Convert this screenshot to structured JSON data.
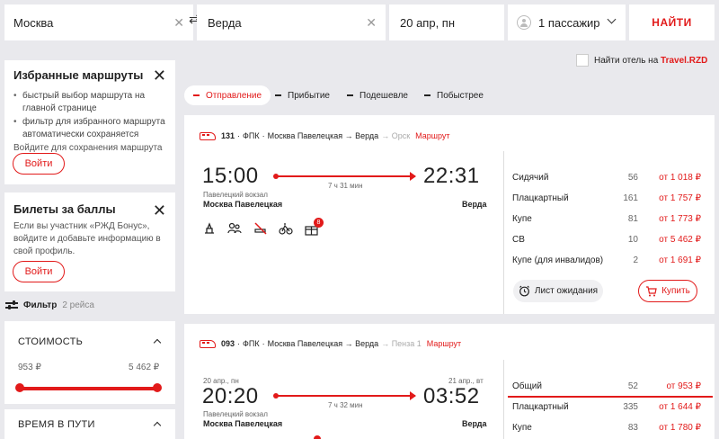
{
  "search": {
    "from": "Москва",
    "to": "Верда",
    "date": "20 апр, пн",
    "passengers": "1 пассажир",
    "find_label": "НАЙТИ"
  },
  "hotel": {
    "prefix": "Найти отель на",
    "brand": "Travel.RZD"
  },
  "favorites": {
    "title": "Избранные маршруты",
    "bullets": [
      "быстрый выбор маршрута на главной странице",
      "фильтр для избранного маршрута автоматически сохраняется"
    ],
    "hint": "Войдите для сохранения маршрута",
    "login": "Войти"
  },
  "bonus": {
    "title": "Билеты за баллы",
    "text": "Если вы участник «РЖД Бонус», войдите и добавьте информацию в свой профиль.",
    "login": "Войти"
  },
  "filter": {
    "label": "Фильтр",
    "count": "2 рейса",
    "cost_title": "СТОИМОСТЬ",
    "min": "953 ₽",
    "max": "5 462 ₽",
    "travel_time_title": "ВРЕМЯ В ПУТИ"
  },
  "sort": {
    "tabs": [
      "Отправление",
      "Прибытие",
      "Подешевле",
      "Побыстрее"
    ],
    "active": 0
  },
  "trains": [
    {
      "number": "131",
      "carrier": "ФПК",
      "route": "Москва Павелецкая → Верда",
      "extra": "→ Орск",
      "route_link": "Маршрут",
      "dep_date": "",
      "arr_date": "",
      "dep_time": "15:00",
      "arr_time": "22:31",
      "duration": "7 ч 31 мин",
      "dep_station_note": "Павелецкий вокзал",
      "dep_station": "Москва Павелецкая",
      "arr_station": "Верда",
      "amenities": [
        "pet-icon",
        "companions-icon",
        "no-smoking-icon",
        "bike-icon",
        "gift-box-icon"
      ],
      "gift_badge": "8",
      "classes": [
        {
          "name": "Сидячий",
          "count": "56",
          "price": "от 1 018 ₽"
        },
        {
          "name": "Плацкартный",
          "count": "161",
          "price": "от 1 757 ₽"
        },
        {
          "name": "Купе",
          "count": "81",
          "price": "от 1 773 ₽"
        },
        {
          "name": "СВ",
          "count": "10",
          "price": "от 5 462 ₽"
        },
        {
          "name": "Купе (для инвалидов)",
          "count": "2",
          "price": "от 1 691 ₽"
        }
      ],
      "wait_label": "Лист ожидания",
      "buy_label": "Купить"
    },
    {
      "number": "093",
      "carrier": "ФПК",
      "route": "Москва Павелецкая → Верда",
      "extra": "→ Пенза 1",
      "route_link": "Маршрут",
      "dep_date": "20 апр., пн",
      "arr_date": "21 апр., вт",
      "dep_time": "20:20",
      "arr_time": "03:52",
      "duration": "7 ч 32 мин",
      "dep_station_note": "Павелецкий вокзал",
      "dep_station": "Москва Павелецкая",
      "arr_station": "Верда",
      "classes": [
        {
          "name": "Общий",
          "count": "52",
          "price": "от 953 ₽"
        },
        {
          "name": "Плацкартный",
          "count": "335",
          "price": "от 1 644 ₽"
        },
        {
          "name": "Купе",
          "count": "83",
          "price": "от 1 780 ₽"
        }
      ]
    }
  ]
}
